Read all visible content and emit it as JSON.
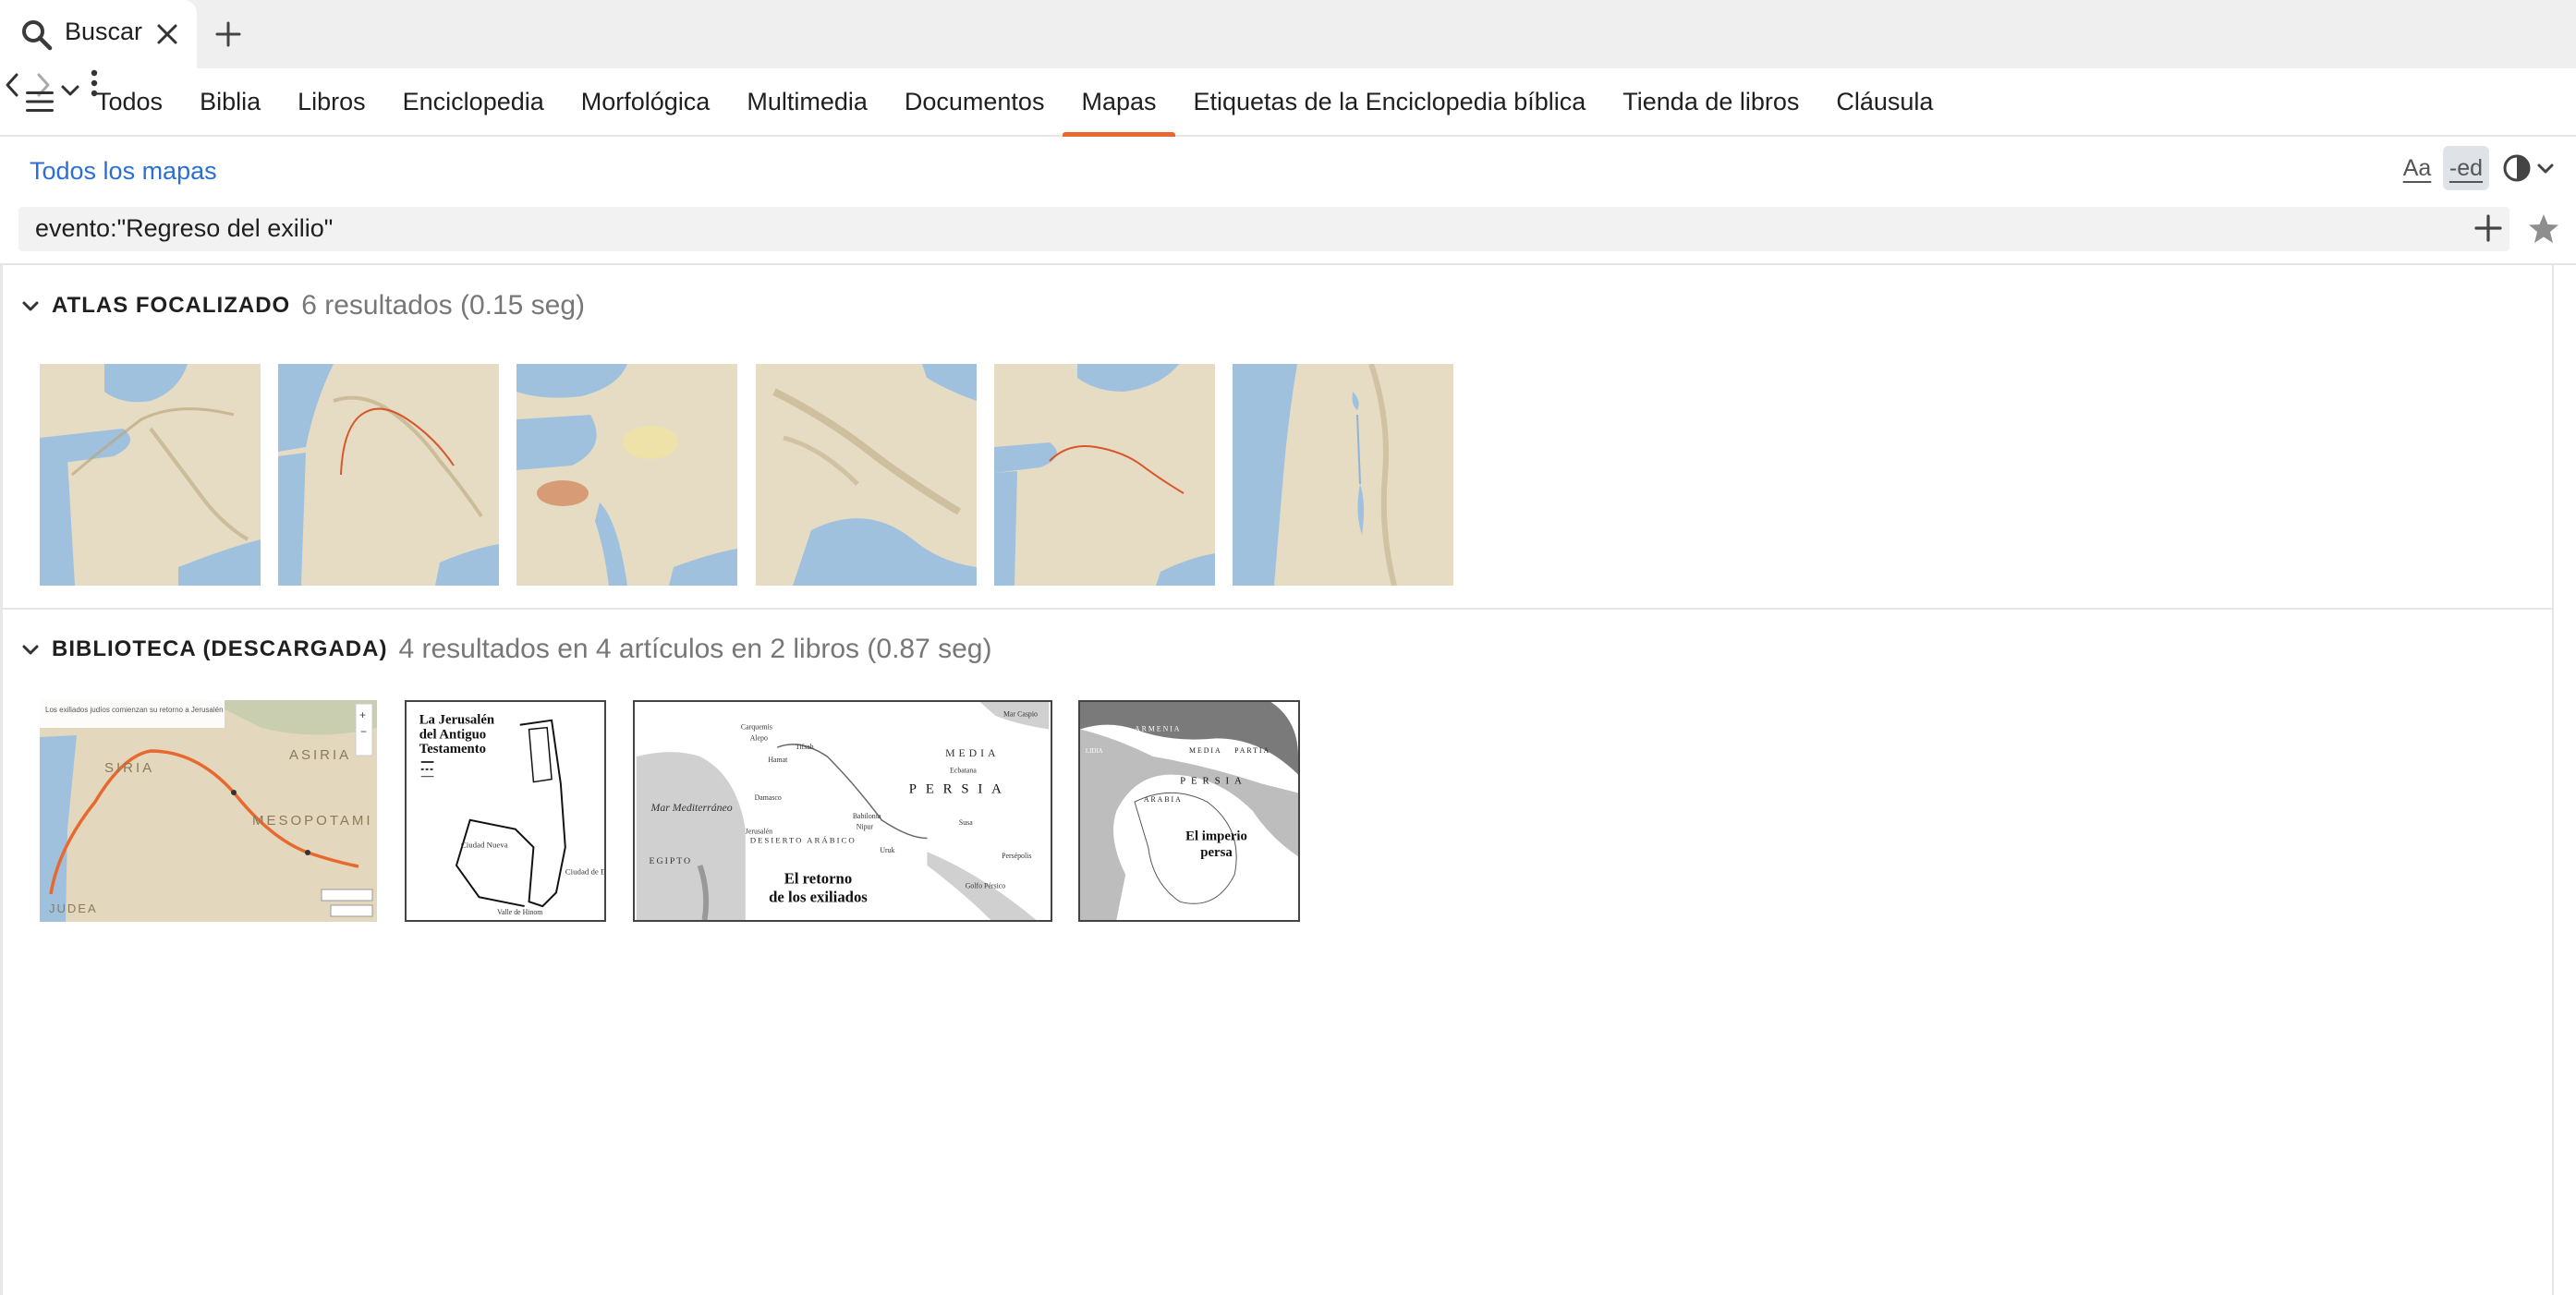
{
  "tab": {
    "label": "Buscar"
  },
  "nav": {
    "tabs": [
      "Todos",
      "Biblia",
      "Libros",
      "Enciclopedia",
      "Morfológica",
      "Multimedia",
      "Documentos",
      "Mapas",
      "Etiquetas de la Enciclopedia bíblica",
      "Tienda de libros",
      "Cláusula"
    ],
    "active_tab": "Mapas"
  },
  "header": {
    "all_maps_link": "Todos los mapas",
    "font_tool": "Aa",
    "ed_tool": "-ed"
  },
  "query": {
    "value": "evento:\"Regreso del exilio\""
  },
  "sections": {
    "atlas": {
      "title": "ATLAS FOCALIZADO",
      "meta": "6 resultados (0.15 seg)",
      "thumbnails": [
        "map-near-east",
        "map-route-mesopotamia",
        "map-egypt-region",
        "map-persia",
        "map-route-west",
        "map-levant"
      ]
    },
    "library": {
      "title": "BIBLIOTECA (DESCARGADA)",
      "meta": "4 resultados en 4 artículos en 2 libros (0.87 seg)",
      "thumbnails": [
        {
          "kind": "color-map",
          "labels": [
            "SIRIA",
            "ASIRIA",
            "MESOPOTAMI",
            "JUDEA"
          ],
          "caption": "Los exiliados judíos comienzan su retorno a Jerusalén"
        },
        {
          "kind": "plan",
          "title_lines": [
            "La Jerusalén",
            "del Antiguo",
            "Testamento"
          ],
          "labels": [
            "Ciudad Nueva",
            "Ciudad de David",
            "Valle de Hinom"
          ]
        },
        {
          "kind": "bw-map",
          "title_lines": [
            "El retorno",
            "de los exiliados"
          ],
          "labels": [
            "Mar Mediterráneo",
            "MEDIA",
            "PERSIA",
            "DESIERTO ARÁBICO",
            "EGIPTO",
            "Carquemis",
            "Alepo",
            "Hamat",
            "Tifsah",
            "Damasco",
            "Jerusalén",
            "Babilonia",
            "Nipur",
            "Uruk",
            "Susa",
            "Ecbatana",
            "Persépolis",
            "Golfo Pérsico",
            "Mar Caspio"
          ]
        },
        {
          "kind": "bw-map",
          "title_lines": [
            "El imperio",
            "persa"
          ],
          "labels": [
            "ARMENIA",
            "MEDIA",
            "PARTIA",
            "PERSIA",
            "LIDIA",
            "ARABIA"
          ]
        }
      ]
    }
  },
  "colors": {
    "accent": "#e8692f",
    "link": "#2a6fd1",
    "sea": "#9fc1de",
    "land": "#e7dcc3"
  }
}
